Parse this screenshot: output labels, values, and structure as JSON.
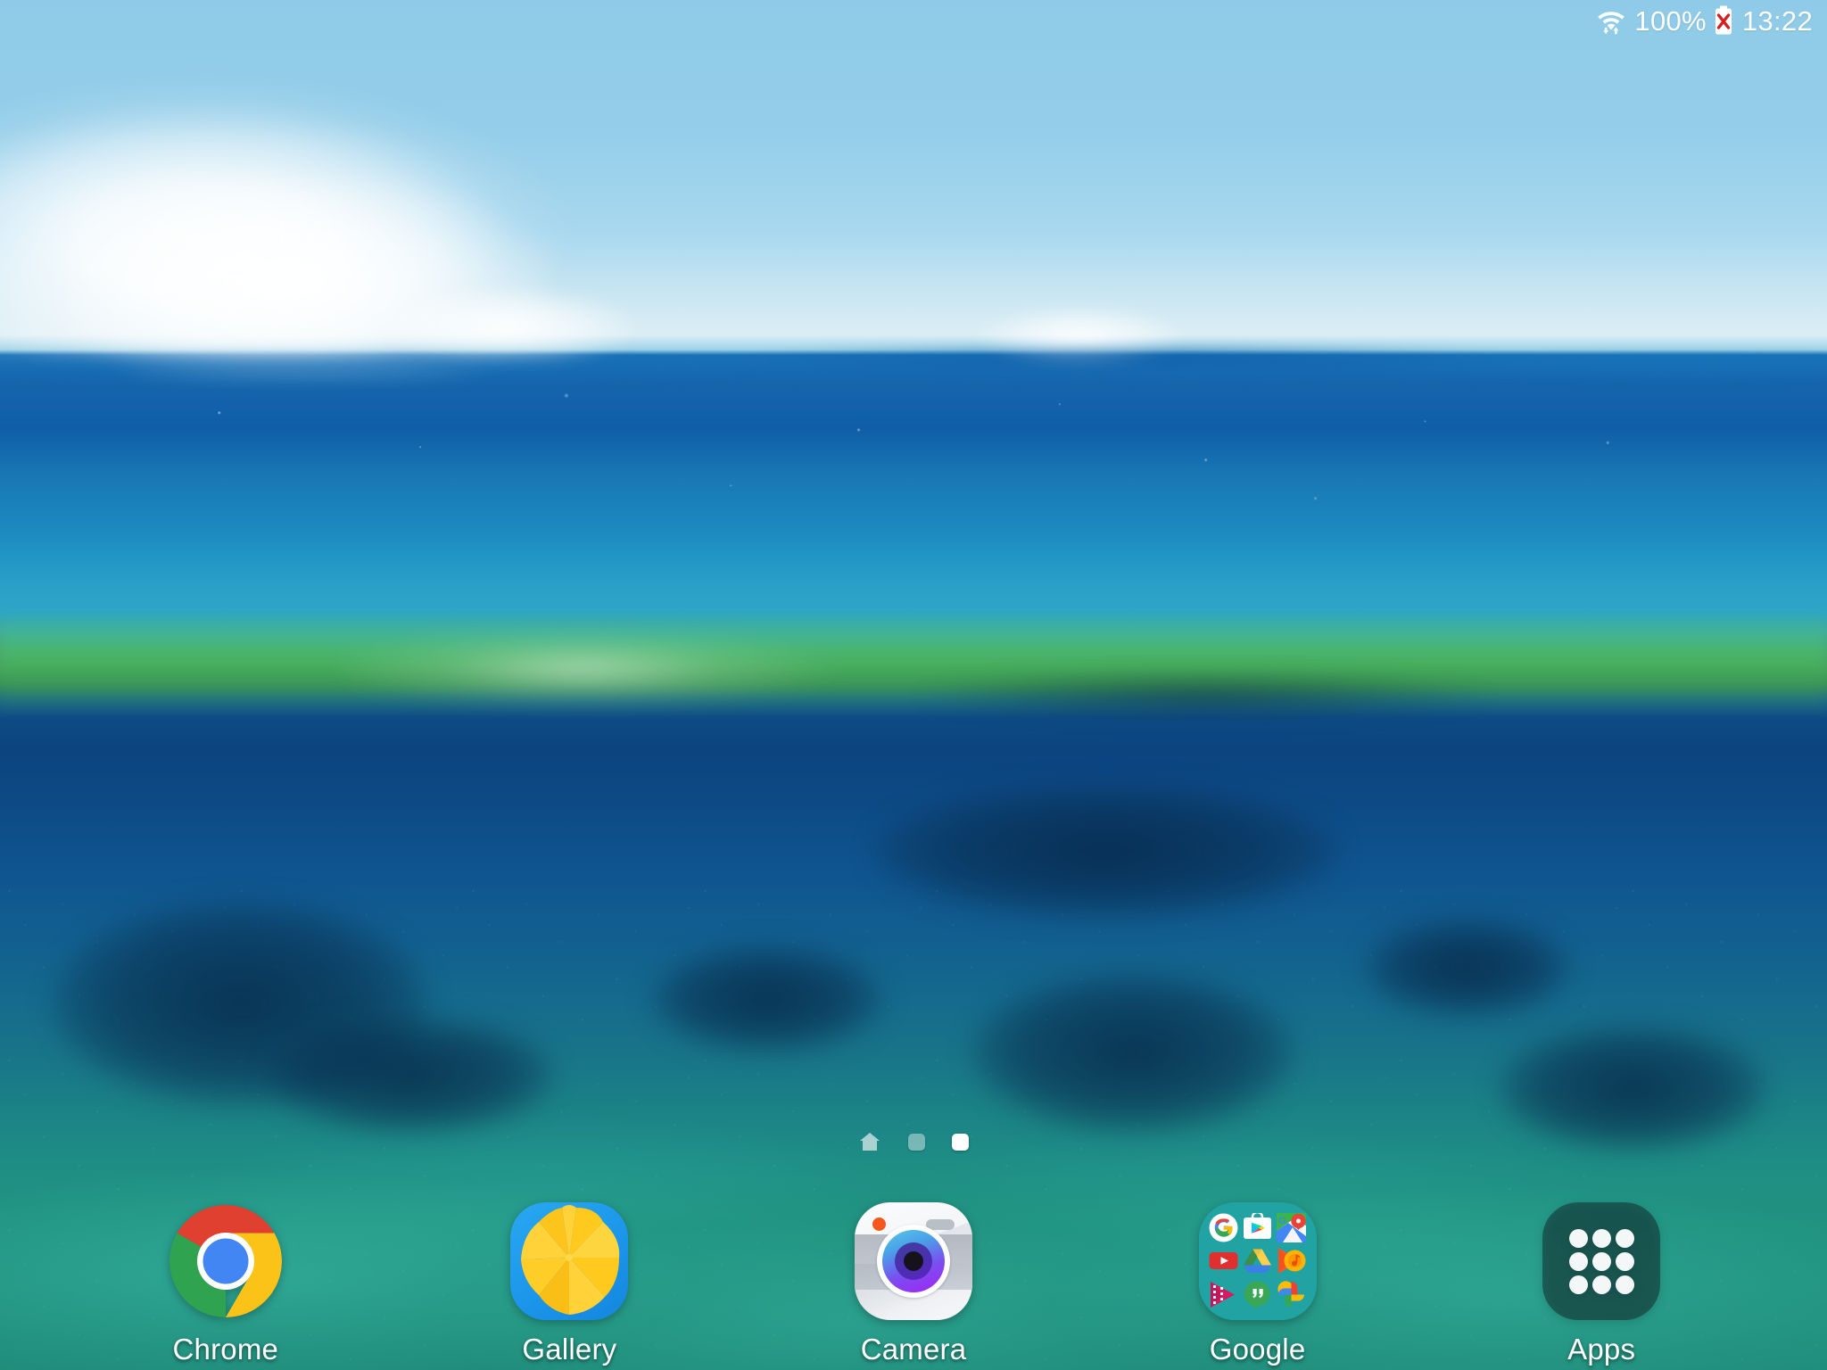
{
  "status_bar": {
    "wifi_icon": "wifi-icon",
    "wifi_transfer_icon": "wifi-data-transfer-icon",
    "battery_percent": "100%",
    "battery_icon": "battery-not-charging-icon",
    "clock": "13:22",
    "text_color": "#ffffff",
    "battery_error_color": "#d32020"
  },
  "wallpaper": {
    "name": "underwater-ocean-wallpaper",
    "sky_color": "#93cde9",
    "surface_water_color": "#1565ad",
    "algae_band_color": "#47a25c",
    "deep_water_color": "#0c4480",
    "seafloor_color": "#26a68c"
  },
  "page_indicator": {
    "pages": [
      {
        "type": "home",
        "label": "home-page-indicator",
        "active": false
      },
      {
        "type": "dot",
        "label": "page-2-indicator",
        "active": false
      },
      {
        "type": "dot",
        "label": "page-3-indicator",
        "active": true
      }
    ],
    "active_index": 2,
    "total": 3
  },
  "dock": {
    "items": [
      {
        "id": "chrome",
        "label": "Chrome",
        "icon": "chrome-icon"
      },
      {
        "id": "gallery",
        "label": "Gallery",
        "icon": "gallery-icon"
      },
      {
        "id": "camera",
        "label": "Camera",
        "icon": "camera-icon"
      },
      {
        "id": "google",
        "label": "Google",
        "icon": "google-folder-icon"
      },
      {
        "id": "apps",
        "label": "Apps",
        "icon": "apps-drawer-icon"
      }
    ],
    "label_color": "#ffffff"
  },
  "google_folder": {
    "background_color": "#21a3a3",
    "apps": [
      {
        "name": "Google",
        "icon": "google-search-icon"
      },
      {
        "name": "Play Store",
        "icon": "play-store-icon"
      },
      {
        "name": "Maps",
        "icon": "google-maps-icon"
      },
      {
        "name": "YouTube",
        "icon": "youtube-icon"
      },
      {
        "name": "Drive",
        "icon": "google-drive-icon"
      },
      {
        "name": "Play Music",
        "icon": "play-music-icon"
      },
      {
        "name": "Play Movies",
        "icon": "play-movies-icon"
      },
      {
        "name": "Hangouts",
        "icon": "hangouts-icon"
      },
      {
        "name": "Photos",
        "icon": "google-photos-icon"
      }
    ]
  }
}
